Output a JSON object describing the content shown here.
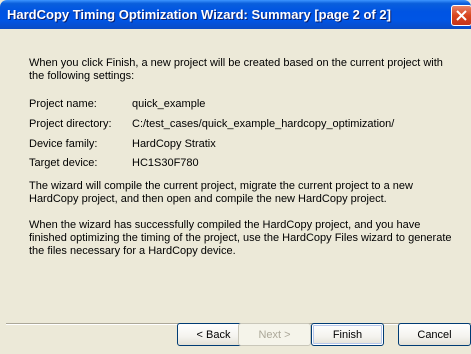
{
  "window": {
    "title": "HardCopy Timing Optimization Wizard: Summary [page 2 of 2]"
  },
  "intro": "When you click Finish, a new project will be created based on the current project with the following settings:",
  "settings": [
    {
      "label": "Project name:",
      "value": "quick_example"
    },
    {
      "label": "Project directory:",
      "value": "C:/test_cases/quick_example_hardcopy_optimization/"
    },
    {
      "label": "Device family:",
      "value": "HardCopy Stratix"
    },
    {
      "label": "Target device:",
      "value": "HC1S30F780"
    }
  ],
  "paragraph1": "The wizard will compile the current project, migrate the current project to a new HardCopy project, and then open and compile the new HardCopy project.",
  "paragraph2": "When the wizard has successfully compiled the HardCopy project, and you have finished optimizing the timing of the project, use the HardCopy Files wizard to generate the files necessary for a HardCopy device.",
  "buttons": {
    "back": "< Back",
    "next": "Next >",
    "finish": "Finish",
    "cancel": "Cancel"
  }
}
